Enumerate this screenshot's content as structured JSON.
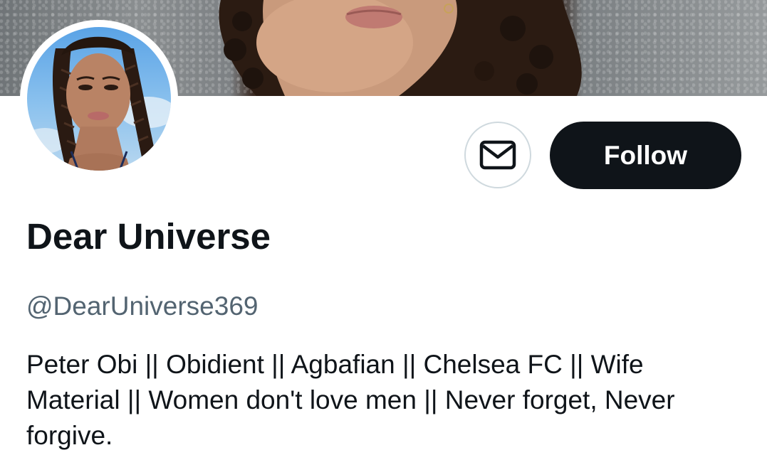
{
  "profile": {
    "display_name": "Dear Universe",
    "handle": "@DearUniverse369",
    "bio": "Peter Obi || Obidient || Agbafian || Chelsea FC || Wife Material || Women don't love men || Never forget, Never forgive."
  },
  "actions": {
    "message_icon": "envelope-icon",
    "follow_label": "Follow"
  },
  "colors": {
    "follow_button_bg": "#0f1419",
    "handle_text": "#536471",
    "primary_text": "#0f1419",
    "button_border": "#cfd9de"
  }
}
